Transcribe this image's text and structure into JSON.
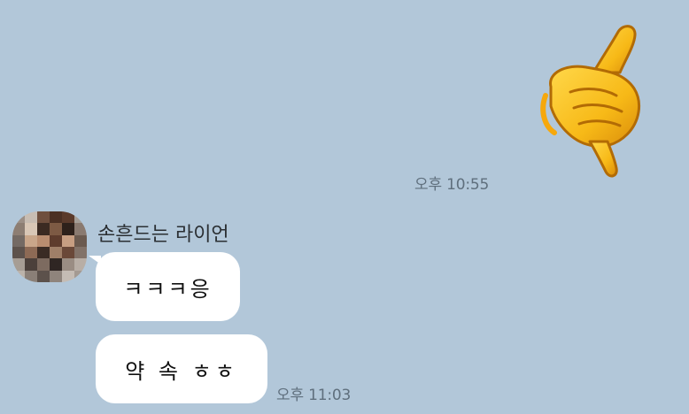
{
  "chat": {
    "background_color": "#b2c7d9",
    "outgoing": {
      "sticker_icon": "call-me-hand-emoji",
      "time": "오후 10:55"
    },
    "incoming": {
      "sender_name": "손흔드는 라이언",
      "avatar": "pixelated-profile-photo",
      "messages": [
        {
          "text": "ㅋㅋㅋ응"
        },
        {
          "text": "약 속 ㅎㅎ"
        }
      ],
      "time": "오후 11:03"
    }
  }
}
